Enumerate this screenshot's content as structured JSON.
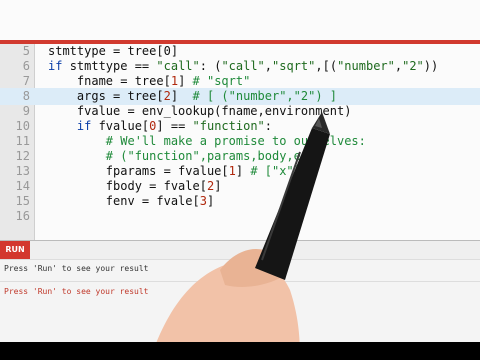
{
  "editor": {
    "lines": [
      {
        "n": "5",
        "parts": [
          [
            "",
            "stmttype = tree[0]"
          ]
        ]
      },
      {
        "n": "6",
        "parts": [
          [
            "kw",
            "if "
          ],
          [
            "",
            "stmttype == "
          ],
          [
            "str",
            "\"call\""
          ],
          [
            "",
            ": ("
          ],
          [
            "str",
            "\"call\""
          ],
          [
            "",
            ","
          ],
          [
            "str",
            "\"sqrt\""
          ],
          [
            "",
            ",[("
          ],
          [
            "str",
            "\"number\""
          ],
          [
            "",
            ","
          ],
          [
            "str",
            "\"2\""
          ],
          [
            "",
            "))"
          ]
        ]
      },
      {
        "n": "7",
        "parts": [
          [
            "",
            "    fname = tree["
          ],
          [
            "num",
            "1"
          ],
          [
            "",
            "] "
          ],
          [
            "cm",
            "# \"sqrt\""
          ]
        ]
      },
      {
        "n": "8",
        "parts": [
          [
            "",
            "    args = tree["
          ],
          [
            "num",
            "2"
          ],
          [
            "",
            "]  "
          ],
          [
            "cm",
            "# [ (\"number\",\"2\") ]"
          ]
        ]
      },
      {
        "n": "9",
        "parts": [
          [
            "",
            "    fvalue = env_lookup(fname,environment)"
          ]
        ]
      },
      {
        "n": "10",
        "parts": [
          [
            "kw",
            "    if "
          ],
          [
            "",
            "fvalue["
          ],
          [
            "num",
            "0"
          ],
          [
            "",
            "] == "
          ],
          [
            "str",
            "\"function\""
          ],
          [
            "",
            ":"
          ]
        ]
      },
      {
        "n": "11",
        "parts": [
          [
            "cm",
            "        # We'll make a promise to ourselves:"
          ]
        ]
      },
      {
        "n": "12",
        "parts": [
          [
            "cm",
            "        # (\"function\",params,body,env)"
          ]
        ]
      },
      {
        "n": "13",
        "parts": [
          [
            "",
            "        fparams = fvalue["
          ],
          [
            "num",
            "1"
          ],
          [
            "",
            "] "
          ],
          [
            "cm",
            "# [\"x\"]"
          ]
        ]
      },
      {
        "n": "14",
        "parts": [
          [
            "",
            "        fbody = fvale["
          ],
          [
            "num",
            "2"
          ],
          [
            "",
            "]"
          ]
        ]
      },
      {
        "n": "15",
        "parts": [
          [
            "",
            "        fenv = fvale["
          ],
          [
            "num",
            "3"
          ],
          [
            "",
            "]"
          ]
        ]
      },
      {
        "n": "16",
        "parts": [
          [
            "",
            ""
          ]
        ]
      }
    ],
    "highlighted_line": "8"
  },
  "run_label": "RUN",
  "output": {
    "line1": "Press 'Run' to see your result",
    "line2": "Press 'Run' to see your result"
  },
  "colors": {
    "accent": "#d13a2f",
    "keyword": "#0a3ea8",
    "string": "#1e6a1e",
    "comment": "#1f8a3a"
  }
}
